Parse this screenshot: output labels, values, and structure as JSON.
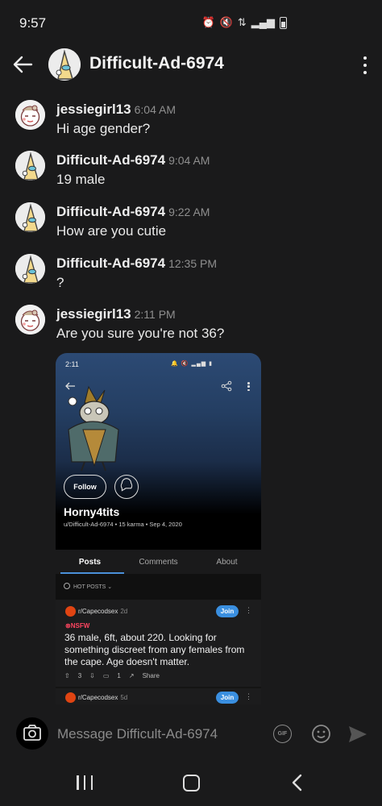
{
  "status_bar": {
    "time": "9:57",
    "icons": [
      "alarm-icon",
      "mute-icon",
      "data-icon",
      "signal-icon",
      "battery-icon"
    ]
  },
  "header": {
    "title": "Difficult-Ad-6974",
    "back_icon": "back-arrow-icon",
    "menu_icon": "more-vertical-icon"
  },
  "messages": [
    {
      "author": "jessiegirl13",
      "time": "6:04 AM",
      "text": "Hi age gender?",
      "avatar": "jessie-avatar"
    },
    {
      "author": "Difficult-Ad-6974",
      "time": "9:04 AM",
      "text": "19 male",
      "avatar": "difficult-avatar"
    },
    {
      "author": "Difficult-Ad-6974",
      "time": "9:22 AM",
      "text": "How are you cutie",
      "avatar": "difficult-avatar"
    },
    {
      "author": "Difficult-Ad-6974",
      "time": "12:35 PM",
      "text": "?",
      "avatar": "difficult-avatar"
    },
    {
      "author": "jessiegirl13",
      "time": "2:11 PM",
      "text": "Are you sure you're not 36?",
      "avatar": "jessie-avatar"
    }
  ],
  "attachment": {
    "status_time": "2:11",
    "follow_label": "Follow",
    "profile_name": "Horny4tits",
    "profile_sub": "u/Difficult-Ad-6974 • 15 karma • Sep 4, 2020",
    "tabs": [
      {
        "label": "Posts",
        "active": true
      },
      {
        "label": "Comments",
        "active": false
      },
      {
        "label": "About",
        "active": false
      }
    ],
    "sort_label": "HOT POSTS",
    "posts": [
      {
        "subreddit": "r/Capecodsex",
        "age": "2d",
        "join_label": "Join",
        "nsfw_label": "NSFW",
        "title": "36 male, 6ft, about 220. Looking for something discreet from any females from the cape. Age doesn't matter.",
        "upvotes": "3",
        "comments": "1",
        "share_label": "Share"
      },
      {
        "subreddit": "r/Capecodsex",
        "age": "5d",
        "join_label": "Join"
      }
    ]
  },
  "composer": {
    "placeholder": "Message Difficult-Ad-6974",
    "gif_label": "GIF"
  },
  "colors": {
    "background": "#1a1a1b",
    "accent_blue": "#3a8fe0",
    "nsfw_red": "#ff4560",
    "subreddit_orange": "#e04412"
  }
}
